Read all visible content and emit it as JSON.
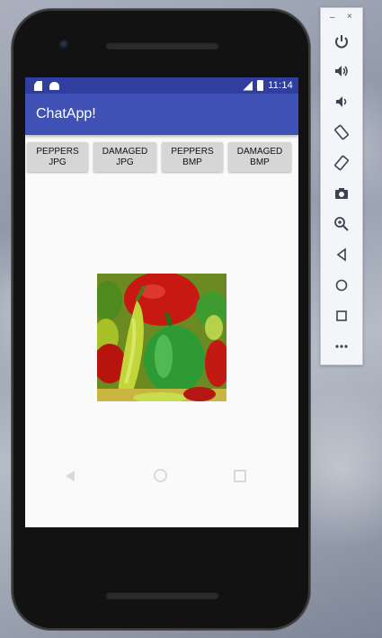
{
  "status_bar": {
    "time": "11:14"
  },
  "app_bar": {
    "title": "ChatApp!"
  },
  "buttons": [
    {
      "line1": "PEPPERS",
      "line2": "JPG"
    },
    {
      "line1": "DAMAGED",
      "line2": "JPG"
    },
    {
      "line1": "PEPPERS",
      "line2": "BMP"
    },
    {
      "line1": "DAMAGED",
      "line2": "BMP"
    }
  ],
  "image": {
    "subject": "peppers-photo"
  },
  "emulator_toolbar": {
    "window_controls": {
      "minimize": "–",
      "close": "×"
    },
    "icons": [
      "power-icon",
      "volume-up-icon",
      "volume-down-icon",
      "rotate-left-icon",
      "rotate-right-icon",
      "camera-icon",
      "zoom-icon",
      "back-icon",
      "home-icon",
      "overview-icon",
      "more-icon"
    ]
  },
  "colors": {
    "status_bar": "#303f9f",
    "app_bar": "#3f51b5",
    "button": "#d6d6d6"
  }
}
